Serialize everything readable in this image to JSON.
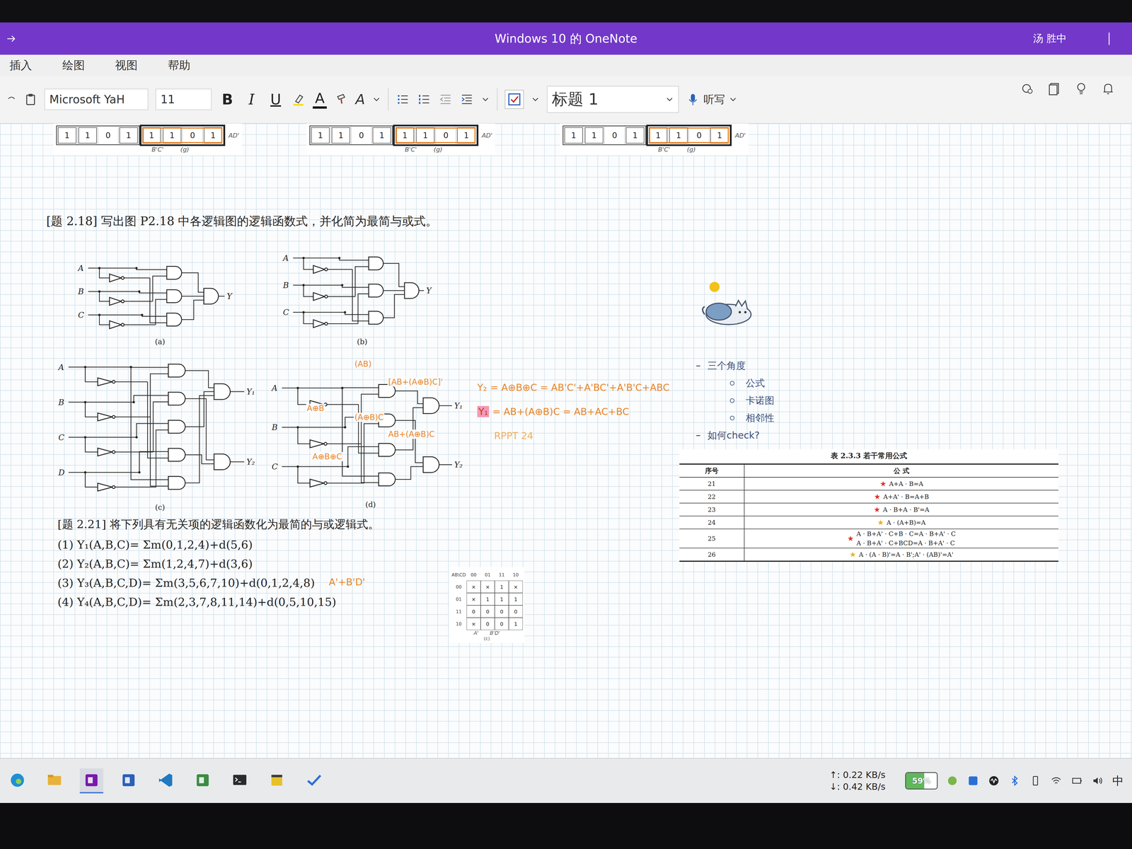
{
  "window": {
    "title": "Windows 10 的 OneNote",
    "user": "汤 胜中"
  },
  "menu": [
    {
      "label": "插入",
      "selected": false
    },
    {
      "label": "绘图",
      "selected": false
    },
    {
      "label": "视图",
      "selected": false
    },
    {
      "label": "帮助",
      "selected": false
    }
  ],
  "toolbar": {
    "font": "Microsoft YaH",
    "size": "11",
    "format_buttons": [
      "B",
      "I",
      "U"
    ],
    "font_color": "A",
    "clear_format": "A",
    "style": "标题 1",
    "dictate": "听写",
    "todo_checked": true
  },
  "kmap_strip": [
    {
      "cells": [
        "1",
        "1",
        "0",
        "1",
        "1",
        "1",
        "0",
        "1"
      ],
      "right_label": "AD'",
      "bottom_label": "B'C'",
      "caption": "(g)"
    },
    {
      "cells": [
        "1",
        "1",
        "0",
        "1",
        "1",
        "1",
        "0",
        "1"
      ],
      "right_label": "AD'",
      "bottom_label": "B'C'",
      "caption": "(g)"
    },
    {
      "cells": [
        "1",
        "1",
        "0",
        "1",
        "1",
        "1",
        "0",
        "1"
      ],
      "right_label": "AD'",
      "bottom_label": "B'C'",
      "caption": "(g)"
    }
  ],
  "problem_218": "[题 2.18]  写出图 P2.18 中各逻辑图的逻辑函数式，并化简为最简与或式。",
  "circuits": [
    {
      "caption": "(a)",
      "inputs": [
        "A",
        "B",
        "C"
      ],
      "outputs": [
        "Y"
      ]
    },
    {
      "caption": "(b)",
      "inputs": [
        "A",
        "B",
        "C"
      ],
      "outputs": [
        "Y"
      ]
    },
    {
      "caption": "(c)",
      "inputs": [
        "A",
        "B",
        "C",
        "D"
      ],
      "outputs": [
        "Y₁",
        "Y₂"
      ]
    },
    {
      "caption": "(d)",
      "inputs": [
        "A",
        "B",
        "C"
      ],
      "outputs": [
        "Y₁",
        "Y₂"
      ]
    }
  ],
  "circuit_d_notes": [
    "(AB)",
    "[AB+(A⊕B)C]'",
    "A⊕B",
    "(A⊕B)C",
    "AB+(A⊕B)C",
    "A⊕B⊕C"
  ],
  "equations": [
    {
      "lhs": "Y₂",
      "rhs": "= A⊕B⊕C = AB'C'+A'BC'+A'B'C+ABC",
      "highlight": false
    },
    {
      "lhs": "Y₁",
      "rhs": "= AB+(A⊕B)C = AB+AC+BC",
      "highlight": true
    }
  ],
  "equation_note": "RPPT 24",
  "outline": {
    "title": "三个角度",
    "items": [
      "公式",
      "卡诺图",
      "相邻性"
    ],
    "footer": "如何check?"
  },
  "formula_table": {
    "caption": "表 2.3.3  若干常用公式",
    "columns": [
      "序号",
      "公  式"
    ],
    "rows": [
      {
        "no": "21",
        "star": "★",
        "color": "#d9342b",
        "formulas": [
          "A+A · B=A"
        ]
      },
      {
        "no": "22",
        "star": "★",
        "color": "#d9342b",
        "formulas": [
          "A+A' · B=A+B"
        ]
      },
      {
        "no": "23",
        "star": "★",
        "color": "#d9342b",
        "formulas": [
          "A · B+A · B'=A"
        ]
      },
      {
        "no": "24",
        "star": "★",
        "color": "#e8b02a",
        "formulas": [
          "A · (A+B)=A"
        ]
      },
      {
        "no": "25",
        "star": "★",
        "color": "#d9342b",
        "formulas": [
          "A · B+A' · C+B · C=A · B+A' · C",
          "A · B+A' · C+BCD=A · B+A' · C"
        ]
      },
      {
        "no": "26",
        "star": "★",
        "color": "#e8b02a",
        "formulas": [
          "A · (A · B)'=A · B';A' · (AB)'=A'"
        ]
      }
    ]
  },
  "problem_221": {
    "title": "[题 2.21]  将下列具有无关项的逻辑函数化为最简的与或逻辑式。",
    "items": [
      {
        "text": "(1) Y₁(A,B,C)= Σm(0,1,2,4)+d(5,6)"
      },
      {
        "text": "(2) Y₂(A,B,C)= Σm(1,2,4,7)+d(3,6)"
      },
      {
        "text": "(3) Y₃(A,B,C,D)= Σm(3,5,6,7,10)+d(0,1,2,4,8)",
        "answer": "A'+B'D'"
      },
      {
        "text": "(4) Y₄(A,B,C,D)= Σm(2,3,7,8,11,14)+d(0,5,10,15)"
      }
    ]
  },
  "small_kmap": {
    "corner": "AB\\CD",
    "col_heads": [
      "00",
      "01",
      "11",
      "10"
    ],
    "row_heads": [
      "00",
      "01",
      "11",
      "10"
    ],
    "cells": [
      [
        "×",
        "×",
        "1",
        "×"
      ],
      [
        "×",
        "1",
        "1",
        "1"
      ],
      [
        "0",
        "0",
        "0",
        "0"
      ],
      [
        "×",
        "0",
        "0",
        "1"
      ]
    ],
    "labels": [
      "A'",
      "B'D'"
    ],
    "caption": "(c)"
  },
  "taskbar": {
    "apps": [
      {
        "kind": "edge",
        "selected": false
      },
      {
        "kind": "files",
        "selected": false
      },
      {
        "kind": "onenote",
        "selected": true
      },
      {
        "kind": "word",
        "selected": false
      },
      {
        "kind": "vscode",
        "selected": false
      },
      {
        "kind": "chart",
        "selected": false
      },
      {
        "kind": "terminal",
        "selected": false
      },
      {
        "kind": "sticky",
        "selected": false
      },
      {
        "kind": "todo",
        "selected": false
      }
    ]
  },
  "tray": {
    "upload": "↑: 0.22 KB/s",
    "download": "↓: 0.42 KB/s",
    "battery": "59%",
    "battery_level": 0.59,
    "ime": "中"
  }
}
